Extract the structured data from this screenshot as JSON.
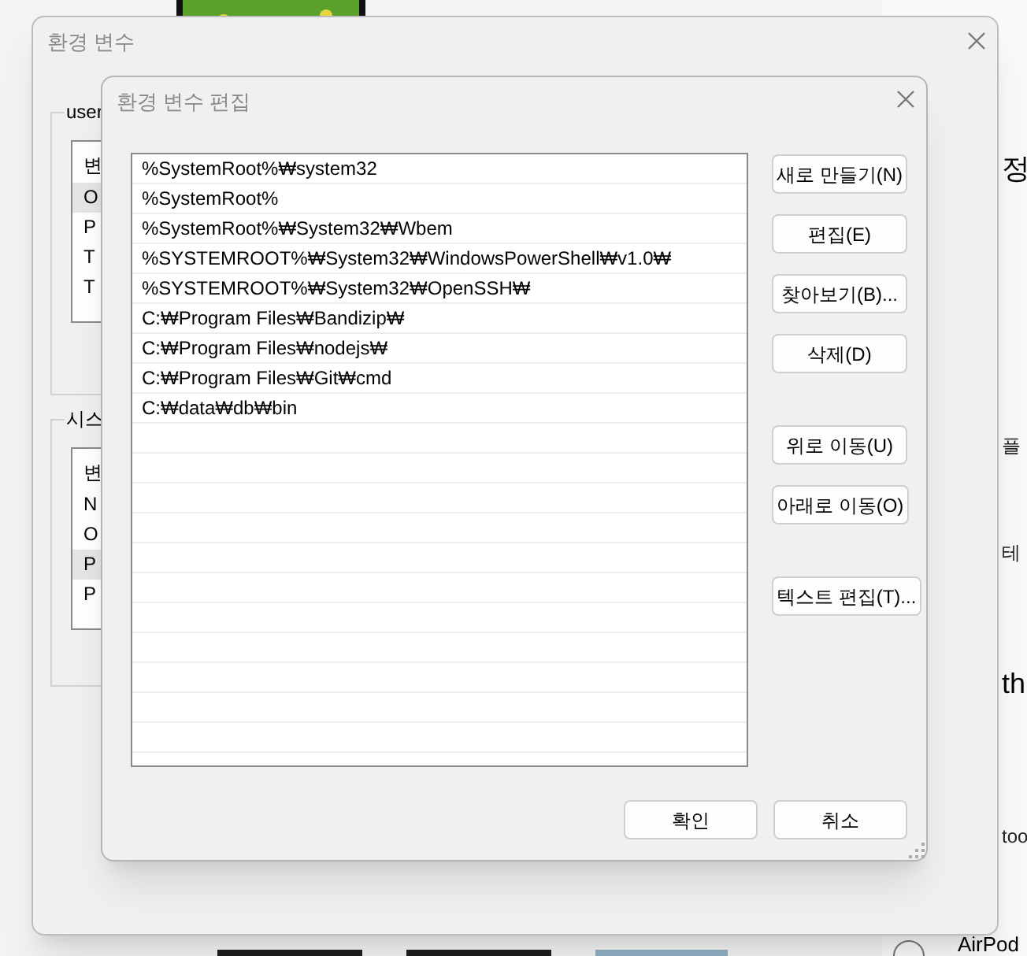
{
  "background": {
    "side_texts": [
      {
        "text": "정",
        "kind": "heading"
      },
      {
        "text": "플",
        "kind": "item"
      },
      {
        "text": "테",
        "kind": "item"
      },
      {
        "text": "th",
        "kind": "heading"
      },
      {
        "text": "too",
        "kind": "item"
      }
    ],
    "bottom_label": "AirPod"
  },
  "env_window": {
    "title": "환경 변수",
    "user_group": {
      "label": "user",
      "header": "변",
      "rows": [
        {
          "text": "O",
          "selected": true
        },
        {
          "text": "P",
          "selected": false
        },
        {
          "text": "T",
          "selected": false
        },
        {
          "text": "T",
          "selected": false
        }
      ]
    },
    "system_group": {
      "label": "시스",
      "header": "변",
      "rows": [
        {
          "text": "N",
          "selected": false
        },
        {
          "text": "O",
          "selected": false
        },
        {
          "text": "P",
          "selected": true
        },
        {
          "text": "P",
          "selected": false
        }
      ]
    }
  },
  "edit_dialog": {
    "title": "환경 변수 편집",
    "paths": [
      "%SystemRoot%₩system32",
      "%SystemRoot%",
      "%SystemRoot%₩System32₩Wbem",
      "%SYSTEMROOT%₩System32₩WindowsPowerShell₩v1.0₩",
      "%SYSTEMROOT%₩System32₩OpenSSH₩",
      "C:₩Program Files₩Bandizip₩",
      "C:₩Program Files₩nodejs₩",
      "C:₩Program Files₩Git₩cmd",
      "C:₩data₩db₩bin"
    ],
    "side_button_groups": [
      [
        "새로 만들기(N)",
        "편집(E)",
        "찾아보기(B)...",
        "삭제(D)"
      ],
      [
        "위로 이동(U)",
        "아래로 이동(O)"
      ],
      [
        "텍스트 편집(T)..."
      ]
    ],
    "footer_buttons": [
      "확인",
      "취소"
    ]
  }
}
